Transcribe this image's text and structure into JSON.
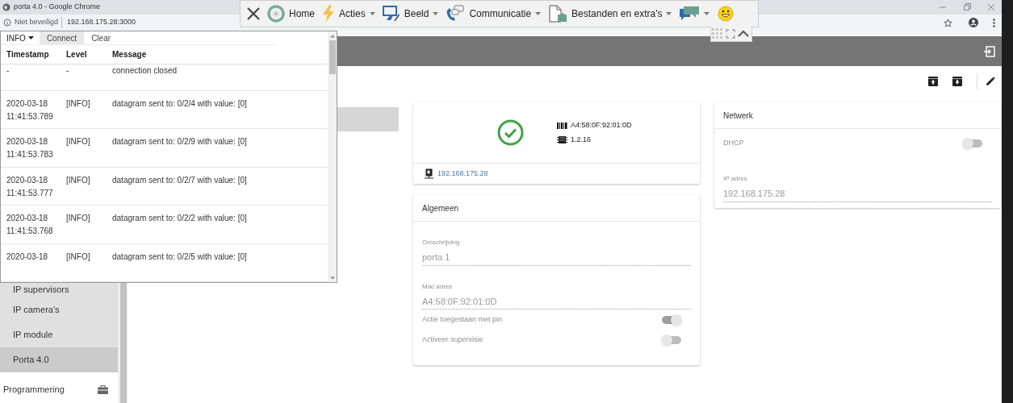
{
  "browser": {
    "title": "porta 4.0 - Google Chrome",
    "security": "Niet beveiligd",
    "url": "192.168.175.28:3000"
  },
  "remote_toolbar": {
    "items": [
      {
        "label": "Home",
        "dropdown": false
      },
      {
        "label": "Acties",
        "dropdown": true
      },
      {
        "label": "Beeld",
        "dropdown": true
      },
      {
        "label": "Communicatie",
        "dropdown": true
      },
      {
        "label": "Bestanden en extra's",
        "dropdown": true
      },
      {
        "dropdown": true
      }
    ]
  },
  "log_panel": {
    "level_filter": "INFO",
    "buttons": [
      {
        "label": "Connect",
        "selected": true
      },
      {
        "label": "Clear",
        "selected": false
      }
    ],
    "columns": [
      "Timestamp",
      "Level",
      "Message"
    ],
    "rows": [
      {
        "timestamp": "-",
        "level": "-",
        "message": "connection closed"
      },
      {
        "timestamp": "2020-03-18 11:41:53.789",
        "level": "[INFO]",
        "message": "datagram sent to: 0/2/4 with value: [0]"
      },
      {
        "timestamp": "2020-03-18 11:41:53.783",
        "level": "[INFO]",
        "message": "datagram sent to: 0/2/9 with value: [0]"
      },
      {
        "timestamp": "2020-03-18 11:41:53.777",
        "level": "[INFO]",
        "message": "datagram sent to: 0/2/7 with value: [0]"
      },
      {
        "timestamp": "2020-03-18 11:41:53.768",
        "level": "[INFO]",
        "message": "datagram sent to: 0/2/2 with value: [0]"
      },
      {
        "timestamp": "2020-03-18",
        "level": "[INFO]",
        "message": "datagram sent to: 0/2/5 with value: [0]"
      }
    ]
  },
  "sidebar": {
    "items": [
      {
        "label": "IP supervisors",
        "selected": false
      },
      {
        "label": "IP camera's",
        "selected": false
      },
      {
        "label": "IP module",
        "selected": false
      },
      {
        "label": "Porta 4.0",
        "selected": true
      }
    ],
    "section": "Programmering"
  },
  "device_card": {
    "mac": "A4:58:0F:92:01:0D",
    "firmware": "1.2.16",
    "ip": "192.168.175.28"
  },
  "general_card": {
    "title": "Algemeen",
    "disabled": true,
    "fields": [
      {
        "label": "Omschrijving",
        "value": "porta 1"
      },
      {
        "label": "Mac adres",
        "value": "A4:58:0F:92:01:0D"
      }
    ],
    "toggles": [
      {
        "label": "Actie toegestaan met pin",
        "on": true
      },
      {
        "label": "Activeer supervisie",
        "on": false
      }
    ]
  },
  "network_card": {
    "title": "Netwerk",
    "disabled": true,
    "toggles": [
      {
        "label": "DHCP",
        "on": false
      }
    ],
    "fields": [
      {
        "label": "IP adres",
        "value": "192.168.175.28"
      }
    ]
  }
}
